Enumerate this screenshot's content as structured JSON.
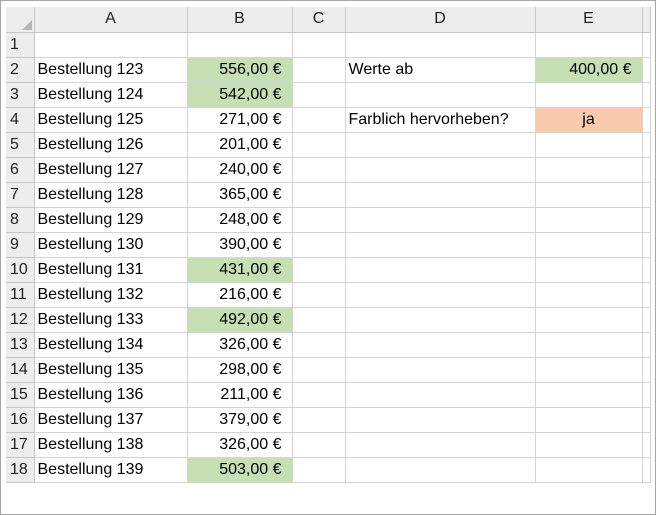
{
  "sheet": {
    "columns": [
      "A",
      "B",
      "C",
      "D",
      "E"
    ],
    "rows": [
      {
        "num": "1",
        "a": "",
        "b": "",
        "b_hl": false,
        "d": "",
        "e": "",
        "e_fill": ""
      },
      {
        "num": "2",
        "a": "Bestellung 123",
        "b": "556,00 €",
        "b_hl": true,
        "d": "Werte ab",
        "e": "400,00 €",
        "e_fill": "green"
      },
      {
        "num": "3",
        "a": "Bestellung 124",
        "b": "542,00 €",
        "b_hl": true,
        "d": "",
        "e": "",
        "e_fill": ""
      },
      {
        "num": "4",
        "a": "Bestellung 125",
        "b": "271,00 €",
        "b_hl": false,
        "d": "Farblich hervorheben?",
        "e": "ja",
        "e_fill": "orange"
      },
      {
        "num": "5",
        "a": "Bestellung 126",
        "b": "201,00 €",
        "b_hl": false,
        "d": "",
        "e": "",
        "e_fill": ""
      },
      {
        "num": "6",
        "a": "Bestellung 127",
        "b": "240,00 €",
        "b_hl": false,
        "d": "",
        "e": "",
        "e_fill": ""
      },
      {
        "num": "7",
        "a": "Bestellung 128",
        "b": "365,00 €",
        "b_hl": false,
        "d": "",
        "e": "",
        "e_fill": ""
      },
      {
        "num": "8",
        "a": "Bestellung 129",
        "b": "248,00 €",
        "b_hl": false,
        "d": "",
        "e": "",
        "e_fill": ""
      },
      {
        "num": "9",
        "a": "Bestellung 130",
        "b": "390,00 €",
        "b_hl": false,
        "d": "",
        "e": "",
        "e_fill": ""
      },
      {
        "num": "10",
        "a": "Bestellung 131",
        "b": "431,00 €",
        "b_hl": true,
        "d": "",
        "e": "",
        "e_fill": ""
      },
      {
        "num": "11",
        "a": "Bestellung 132",
        "b": "216,00 €",
        "b_hl": false,
        "d": "",
        "e": "",
        "e_fill": ""
      },
      {
        "num": "12",
        "a": "Bestellung 133",
        "b": "492,00 €",
        "b_hl": true,
        "d": "",
        "e": "",
        "e_fill": ""
      },
      {
        "num": "13",
        "a": "Bestellung 134",
        "b": "326,00 €",
        "b_hl": false,
        "d": "",
        "e": "",
        "e_fill": ""
      },
      {
        "num": "14",
        "a": "Bestellung 135",
        "b": "298,00 €",
        "b_hl": false,
        "d": "",
        "e": "",
        "e_fill": ""
      },
      {
        "num": "15",
        "a": "Bestellung 136",
        "b": "211,00 €",
        "b_hl": false,
        "d": "",
        "e": "",
        "e_fill": ""
      },
      {
        "num": "16",
        "a": "Bestellung 137",
        "b": "379,00 €",
        "b_hl": false,
        "d": "",
        "e": "",
        "e_fill": ""
      },
      {
        "num": "17",
        "a": "Bestellung 138",
        "b": "326,00 €",
        "b_hl": false,
        "d": "",
        "e": "",
        "e_fill": ""
      },
      {
        "num": "18",
        "a": "Bestellung 139",
        "b": "503,00 €",
        "b_hl": true,
        "d": "",
        "e": "",
        "e_fill": ""
      }
    ]
  },
  "colors": {
    "highlight_green": "#c6e0b4",
    "highlight_orange": "#f8cbad",
    "header_bg": "#ededed",
    "gridline": "#d4d4d4"
  }
}
